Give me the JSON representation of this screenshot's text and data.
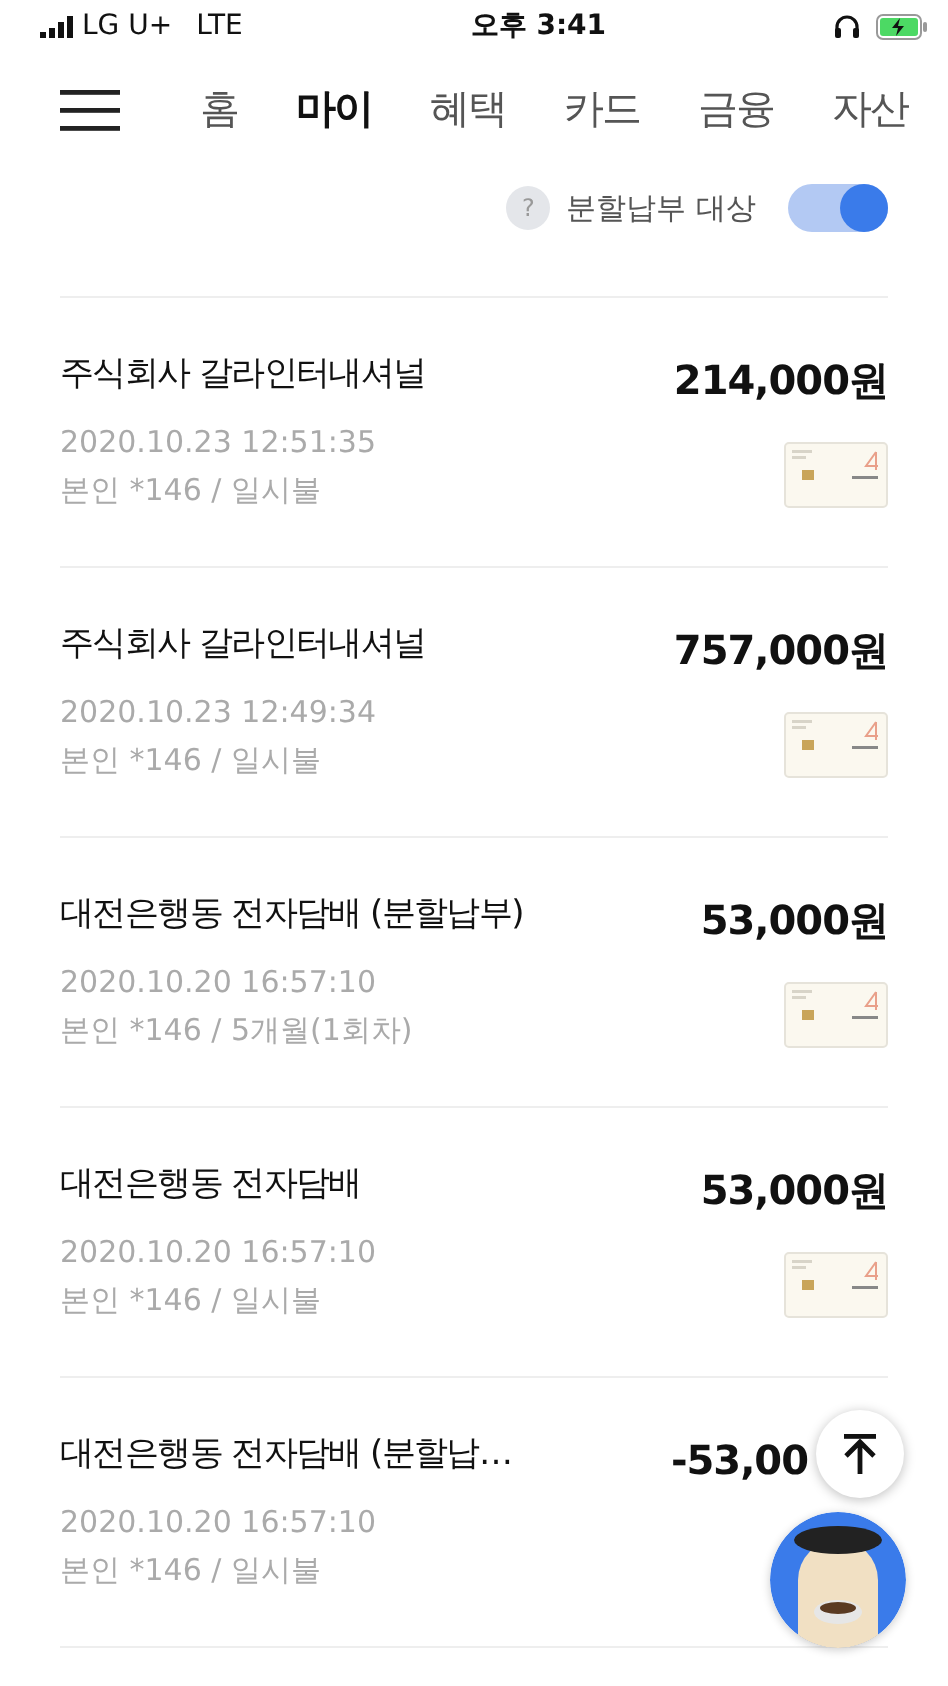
{
  "status_bar": {
    "carrier": "LG U+",
    "network": "LTE",
    "time": "오후 3:41"
  },
  "tabs": [
    {
      "label": "홈",
      "selected": false
    },
    {
      "label": "마이",
      "selected": true
    },
    {
      "label": "혜택",
      "selected": false
    },
    {
      "label": "카드",
      "selected": false
    },
    {
      "label": "금융",
      "selected": false
    },
    {
      "label": "자산",
      "selected": false
    }
  ],
  "filter": {
    "help": "?",
    "label": "분할납부 대상",
    "on": true
  },
  "transactions": [
    {
      "merchant": "주식회사 갈라인터내셔널",
      "amount": "214,000원",
      "datetime": "2020.10.23 12:51:35",
      "detail": "본인 *146 / 일시불",
      "card": true
    },
    {
      "merchant": "주식회사 갈라인터내셔널",
      "amount": "757,000원",
      "datetime": "2020.10.23 12:49:34",
      "detail": "본인 *146 / 일시불",
      "card": true
    },
    {
      "merchant": "대전은행동 전자담배 (분할납부)",
      "amount": "53,000원",
      "datetime": "2020.10.20 16:57:10",
      "detail": "본인 *146 / 5개월(1회차)",
      "card": true
    },
    {
      "merchant": "대전은행동 전자담배",
      "amount": "53,000원",
      "datetime": "2020.10.20 16:57:10",
      "detail": "본인 *146 / 일시불",
      "card": true
    },
    {
      "merchant": "대전은행동 전자담배 (분할납…",
      "amount": "-53,00",
      "datetime": "2020.10.20 16:57:10",
      "detail": "본인 *146 / 일시불",
      "card": false
    }
  ]
}
